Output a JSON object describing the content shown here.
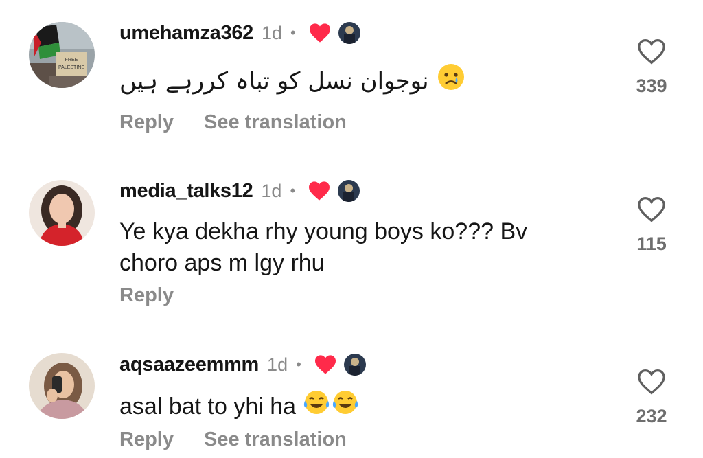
{
  "icons": {
    "like": "heart-outline-icon",
    "creator_like": "heart-filled-icon",
    "creator_avatar": "creator-avatar-icon"
  },
  "colors": {
    "creator_heart": "#ff2a4a",
    "muted": "#8a8a8a",
    "text": "#161616"
  },
  "comments": [
    {
      "username": "umehamza362",
      "time": "1d",
      "separator": "•",
      "text": "نوجوان نسل کو تباہ کررہے ہیں",
      "emoji": "crying-face-icon",
      "like_count": "339",
      "reply_label": "Reply",
      "translate_label": "See translation"
    },
    {
      "username": "media_talks12",
      "time": "1d",
      "separator": "•",
      "text_line1": "Ye kya dekha rhy young boys ko??? Bv",
      "text_line2": "choro aps m lgy rhu",
      "like_count": "115",
      "reply_label": "Reply"
    },
    {
      "username": "aqsaazeemmm",
      "time": "1d",
      "separator": "•",
      "text": "asal bat to yhi ha",
      "emoji": "tears-of-joy-icon",
      "like_count": "232",
      "reply_label": "Reply",
      "translate_label": "See translation"
    }
  ]
}
